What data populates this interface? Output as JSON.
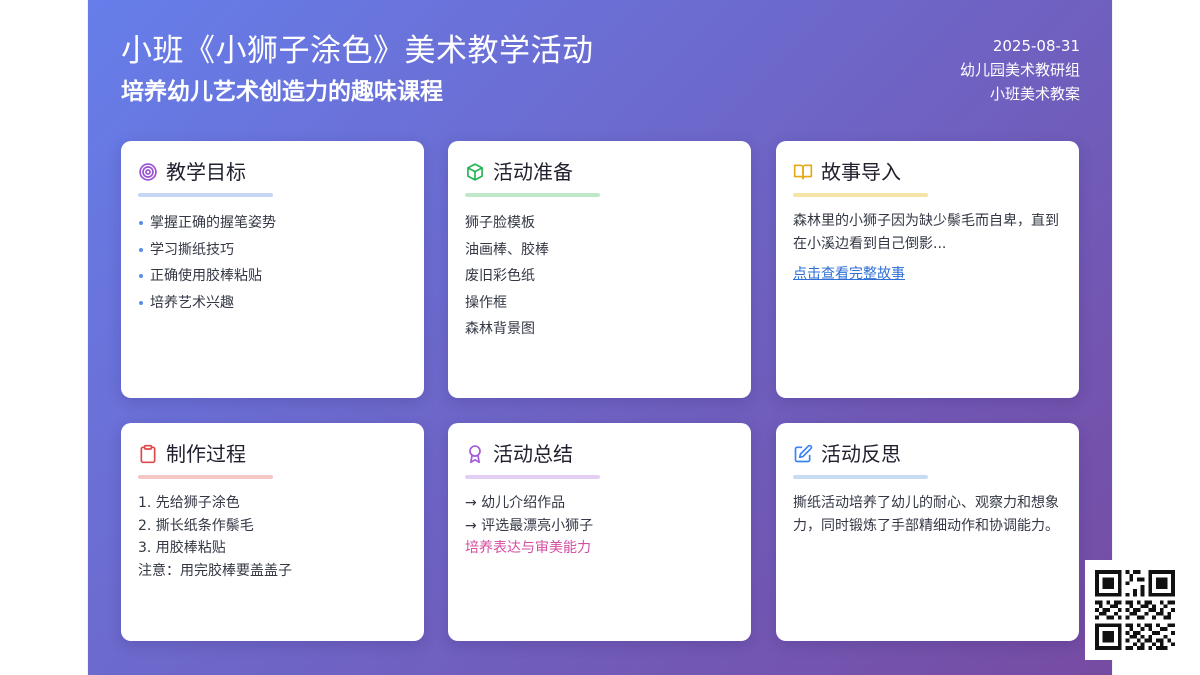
{
  "header": {
    "title": "小班《小狮子涂色》美术教学活动",
    "subtitle": "培养幼儿艺术创造力的趣味课程",
    "date": "2025-08-31",
    "group": "幼儿园美术教研组",
    "doc_type": "小班美术教案"
  },
  "cards": {
    "goals": {
      "icon": "target-icon",
      "title": "教学目标",
      "items": [
        "掌握正确的握笔姿势",
        "学习撕纸技巧",
        "正确使用胶棒粘贴",
        "培养艺术兴趣"
      ]
    },
    "prep": {
      "icon": "box-icon",
      "title": "活动准备",
      "items": [
        "狮子脸模板",
        "油画棒、胶棒",
        "废旧彩色纸",
        "操作框",
        "森林背景图"
      ]
    },
    "story": {
      "icon": "book-icon",
      "title": "故事导入",
      "text": "森林里的小狮子因为缺少鬃毛而自卑，直到在小溪边看到自己倒影...",
      "link": "点击查看完整故事"
    },
    "process": {
      "icon": "clipboard-icon",
      "title": "制作过程",
      "steps": [
        "1. 先给狮子涂色",
        "2. 撕长纸条作鬃毛",
        "3. 用胶棒粘贴",
        "注意：用完胶棒要盖盖子"
      ]
    },
    "summary": {
      "icon": "award-icon",
      "title": "活动总结",
      "lines": [
        "→ 幼儿介绍作品",
        "→ 评选最漂亮小狮子"
      ],
      "highlight": "培养表达与审美能力"
    },
    "reflection": {
      "icon": "edit-icon",
      "title": "活动反思",
      "text": "撕纸活动培养了幼儿的耐心、观察力和想象力，同时锻炼了手部精细动作和协调能力。"
    }
  },
  "colors": {
    "gradient_start": "#667eea",
    "gradient_end": "#764ba2",
    "goals_icon": "#9b4fd1",
    "prep_icon": "#22b455",
    "story_icon": "#e6a817",
    "process_icon": "#e04848",
    "summary_icon": "#a45bd9",
    "reflection_icon": "#3b82f6",
    "link": "#2f6fd6",
    "highlight": "#d44ea0"
  },
  "qr_code": {
    "icon": "qr-code-icon"
  }
}
